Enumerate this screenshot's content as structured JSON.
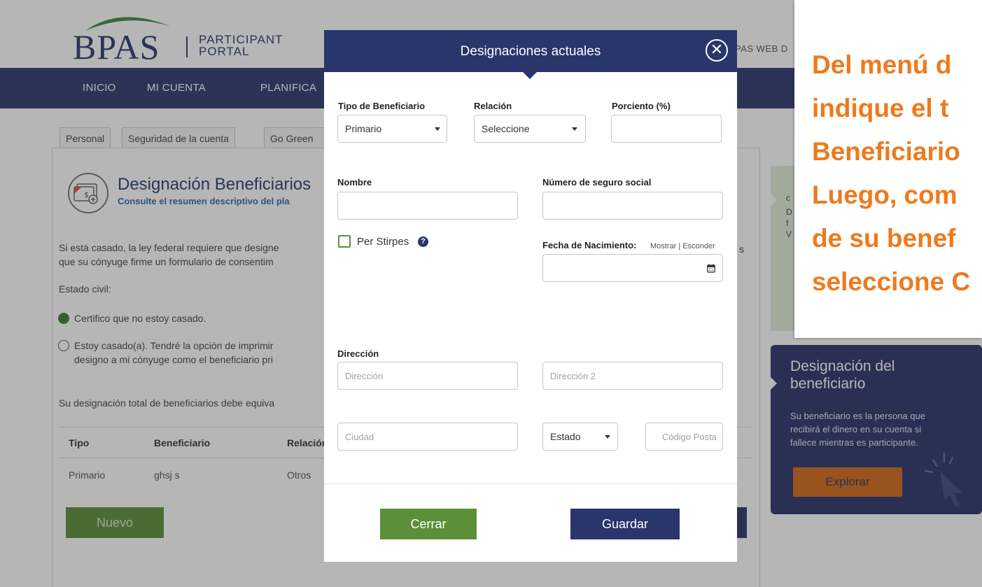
{
  "brand": {
    "logo": "BPAS",
    "subtitle_line1": "PARTICIPANT",
    "subtitle_line2": "PORTAL",
    "header_right": "PAS WEB D"
  },
  "nav": {
    "items": [
      "INICIO",
      "MI CUENTA",
      "PLANIFICA"
    ]
  },
  "tabs": [
    "Personal",
    "Seguridad de la cuenta",
    "Go Green"
  ],
  "designation": {
    "title": "Designación Beneficiarios",
    "subtitle": "Consulte el resumen descriptivo del pla",
    "paragraph_line1": "Si está casado, la ley federal requiere que designe",
    "paragraph_line2": "que su cónyuge firme un formulario de consentim",
    "paragraph_right_fragment": "s",
    "marital_label": "Estado civil:",
    "option_single": "Certifico que no estoy casado.",
    "option_married_line1": "Estoy casado(a). Tendré la opción de imprimir",
    "option_married_line2": "designo a mi cónyuge como el beneficiario pri",
    "total_note": "Su designación total de beneficiarios debe equiva",
    "table": {
      "headers": [
        "Tipo",
        "Beneficiario",
        "Relación"
      ],
      "rows": [
        [
          "Primario",
          "ghsj s",
          "Otros"
        ]
      ]
    },
    "new_button": "Nuevo"
  },
  "sidebar": {
    "green_card": {
      "fragment_lines": [
        "c",
        "D",
        "f",
        "V"
      ]
    },
    "info_card": {
      "title_line1": "Designación del",
      "title_line2": "beneficiario",
      "text_line1": "Su beneficiario es la persona que",
      "text_line2": "recibirá el dinero en su cuenta si",
      "text_line3": "fallece mientras es participante.",
      "button": "Explorar"
    }
  },
  "modal": {
    "title": "Designaciones actuales",
    "close_icon": "circle-x",
    "fields": {
      "tipo_label": "Tipo de Beneficiario",
      "tipo_value": "Primario",
      "relacion_label": "Relación",
      "relacion_value": "Seleccione",
      "porciento_label": "Porciento (%)",
      "porciento_value": "",
      "nombre_label": "Nombre",
      "nombre_value": "",
      "ssn_label": "Número de seguro social",
      "ssn_value": "",
      "show_link": "Mostrar",
      "hide_link": "Esconder",
      "per_stirpes_label": "Per Stirpes",
      "per_stirpes_checked": false,
      "dob_label": "Fecha de Nacimiento:",
      "dob_value": "",
      "address_label": "Dirección",
      "address_placeholder": "Dirección",
      "address2_placeholder": "Dirección 2",
      "city_placeholder": "Ciudad",
      "state_value": "Estado",
      "zip_placeholder": "Código Posta"
    },
    "buttons": {
      "close": "Cerrar",
      "save": "Guardar"
    }
  },
  "callout": {
    "lines": [
      "Del menú d",
      "indique el t",
      "Beneficiario",
      "Luego, com",
      "de su benef",
      "seleccione C"
    ]
  },
  "colors": {
    "navy": "#2a356b",
    "green": "#5c8f3a",
    "orange_text": "#ee7a1d",
    "orange_button": "#d46a17",
    "link_blue": "#2d6ca6"
  }
}
